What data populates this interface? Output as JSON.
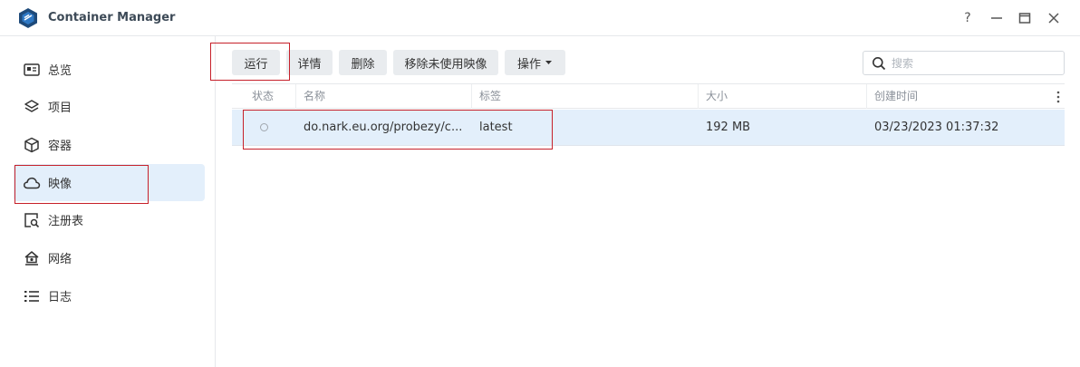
{
  "app": {
    "title": "Container Manager"
  },
  "window": {
    "help": "?"
  },
  "sidebar": {
    "items": [
      {
        "label": "总览",
        "icon": "overview-icon"
      },
      {
        "label": "项目",
        "icon": "layers-icon"
      },
      {
        "label": "容器",
        "icon": "cube-icon"
      },
      {
        "label": "映像",
        "icon": "cloud-icon",
        "active": true
      },
      {
        "label": "注册表",
        "icon": "registry-search-icon"
      },
      {
        "label": "网络",
        "icon": "network-icon"
      },
      {
        "label": "日志",
        "icon": "list-icon"
      }
    ]
  },
  "toolbar": {
    "run": "运行",
    "details": "详情",
    "delete": "删除",
    "remove_unused": "移除未使用映像",
    "actions": "操作",
    "search_placeholder": "搜索"
  },
  "table": {
    "columns": [
      "状态",
      "名称",
      "标签",
      "大小",
      "创建时间"
    ],
    "rows": [
      {
        "name": "do.nark.eu.org/probezy/c...",
        "tag": "latest",
        "size": "192 MB",
        "created": "03/23/2023 01:37:32"
      }
    ]
  },
  "colors": {
    "accent": "#e3effb",
    "annotation": "#c6202a",
    "logo": "#1e4a7a"
  }
}
